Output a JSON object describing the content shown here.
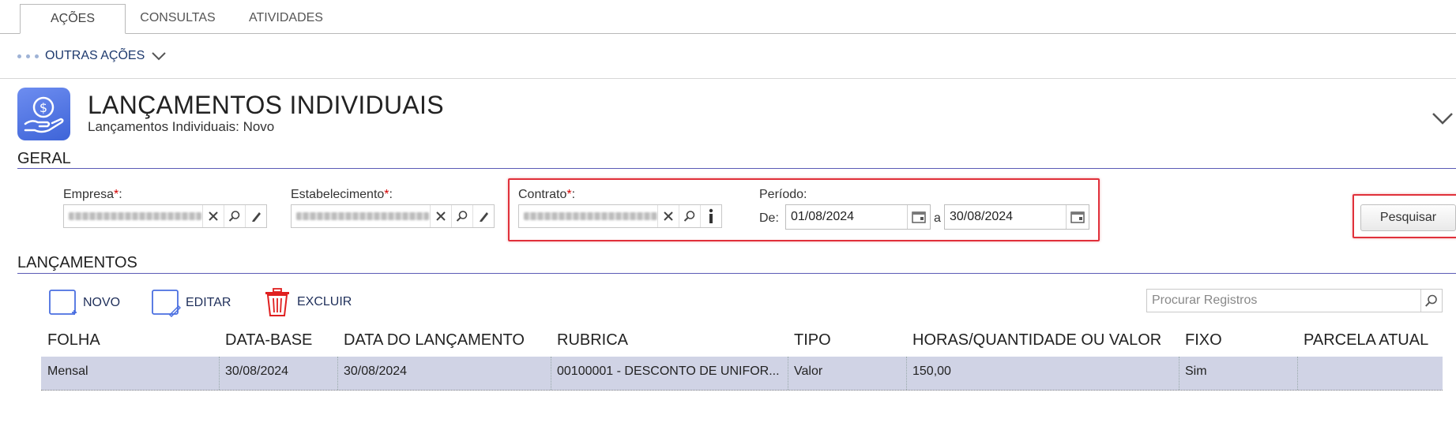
{
  "tabs": [
    {
      "label": "AÇÕES",
      "active": true
    },
    {
      "label": "CONSULTAS",
      "active": false
    },
    {
      "label": "ATIVIDADES",
      "active": false
    }
  ],
  "actions_menu": {
    "label": "OUTRAS AÇÕES"
  },
  "page": {
    "title": "LANÇAMENTOS INDIVIDUAIS",
    "subtitle": "Lançamentos Individuais: Novo",
    "icon": "money-hand-icon"
  },
  "geral": {
    "section_title": "GERAL",
    "empresa": {
      "label": "Empresa",
      "required": "*",
      "suffix": ":"
    },
    "estabelecimento": {
      "label": "Estabelecimento",
      "required": "*",
      "suffix": ":"
    },
    "contrato": {
      "label": "Contrato",
      "required": "*",
      "suffix": ":"
    },
    "periodo": {
      "label": "Período:",
      "from_label": "De:",
      "from_value": "01/08/2024",
      "to_label": "a",
      "to_value": "30/08/2024"
    },
    "search_button": "Pesquisar"
  },
  "lancamentos": {
    "section_title": "LANÇAMENTOS",
    "toolbar": {
      "new": "NOVO",
      "edit": "EDITAR",
      "delete": "EXCLUIR"
    },
    "search_placeholder": "Procurar Registros",
    "columns": [
      "FOLHA",
      "DATA-BASE",
      "DATA DO LANÇAMENTO",
      "RUBRICA",
      "TIPO",
      "HORAS/QUANTIDADE OU VALOR",
      "FIXO",
      "PARCELA ATUAL"
    ],
    "rows": [
      [
        "Mensal",
        "30/08/2024",
        "30/08/2024",
        "00100001 - DESCONTO DE UNIFOR...",
        "Valor",
        "150,00",
        "Sim",
        ""
      ]
    ]
  },
  "colors": {
    "accent": "#5b5bb6",
    "highlight_border": "#e0303a",
    "row_selected": "#d0d3e5",
    "icon_blue": "#4a6fe0"
  }
}
